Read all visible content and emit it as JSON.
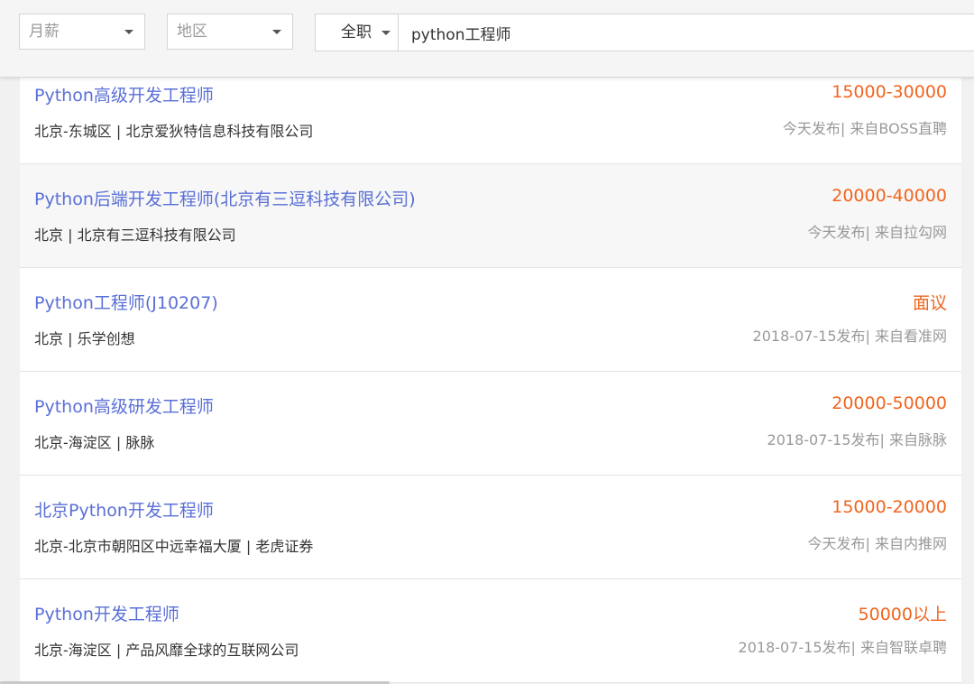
{
  "filters": {
    "salary_placeholder": "月薪",
    "region_placeholder": "地区",
    "job_type": "全职",
    "search_value": "python工程师"
  },
  "jobs": [
    {
      "title": "Python高级开发工程师",
      "salary": "15000-30000",
      "meta": "北京-东城区 |  北京爱狄特信息科技有限公司",
      "source": "今天发布| 来自BOSS直聘"
    },
    {
      "title": "Python后端开发工程师(北京有三逗科技有限公司)",
      "salary": "20000-40000",
      "meta": "北京 |  北京有三逗科技有限公司",
      "source": "今天发布| 来自拉勾网"
    },
    {
      "title": "Python工程师(J10207)",
      "salary": "面议",
      "meta": "北京 |  乐学创想",
      "source": "2018-07-15发布| 来自看准网"
    },
    {
      "title": "Python高级研发工程师",
      "salary": "20000-50000",
      "meta": "北京-海淀区 |  脉脉",
      "source": "2018-07-15发布| 来自脉脉"
    },
    {
      "title": "北京Python开发工程师",
      "salary": "15000-20000",
      "meta": "北京-北京市朝阳区中远幸福大厦 |  老虎证券",
      "source": "今天发布| 来自内推网"
    },
    {
      "title": "Python开发工程师",
      "salary": "50000以上",
      "meta": "北京-海淀区 |  产品风靡全球的互联网公司",
      "source": "2018-07-15发布| 来自智联卓聘"
    }
  ]
}
